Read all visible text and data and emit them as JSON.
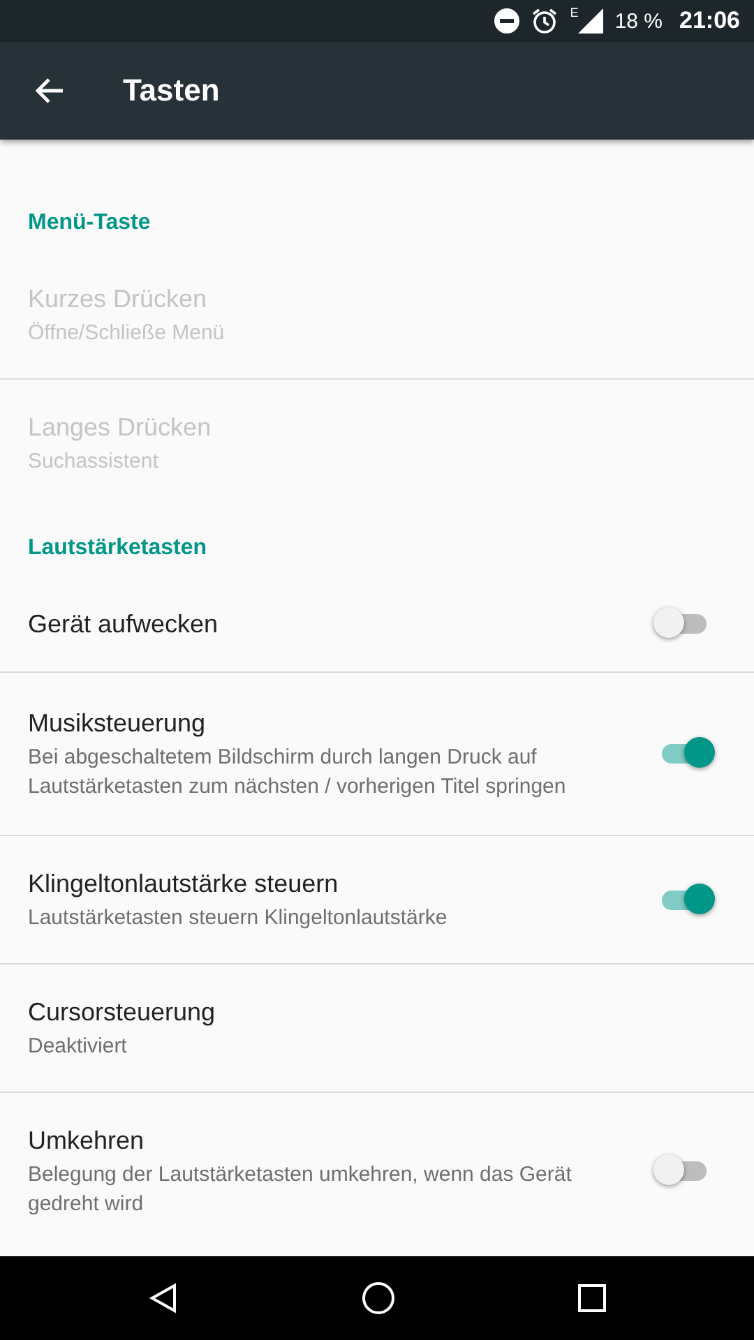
{
  "status_bar": {
    "network_type": "E",
    "battery": "18 %",
    "time": "21:06"
  },
  "app_bar": {
    "title": "Tasten"
  },
  "items": [
    {
      "kind": "header",
      "title": "Menü-Taste"
    },
    {
      "kind": "plain",
      "title": "Kurzes Drücken",
      "summary": "Öffne/Schließe Menü",
      "disabled": true
    },
    {
      "kind": "plain",
      "title": "Langes Drücken",
      "summary": "Suchassistent",
      "disabled": true
    },
    {
      "kind": "header",
      "title": "Lautstärketasten"
    },
    {
      "kind": "switch",
      "title": "Gerät aufwecken",
      "disabled": false,
      "on": false
    },
    {
      "kind": "switch",
      "title": "Musiksteuerung",
      "summary": "Bei abgeschaltetem Bildschirm durch langen Druck auf Lautstärketasten zum nächsten / vorherigen Titel springen",
      "disabled": false,
      "on": true
    },
    {
      "kind": "switch",
      "title": "Klingeltonlautstärke steuern",
      "summary": "Lautstärketasten steuern Klingeltonlautstärke",
      "disabled": false,
      "on": true
    },
    {
      "kind": "plain",
      "title": "Cursorsteuerung",
      "summary": "Deaktiviert",
      "disabled": false
    },
    {
      "kind": "switch",
      "title": "Umkehren",
      "summary": "Belegung der Lautstärketasten umkehren, wenn das Gerät gedreht wird",
      "disabled": false,
      "on": false
    }
  ]
}
